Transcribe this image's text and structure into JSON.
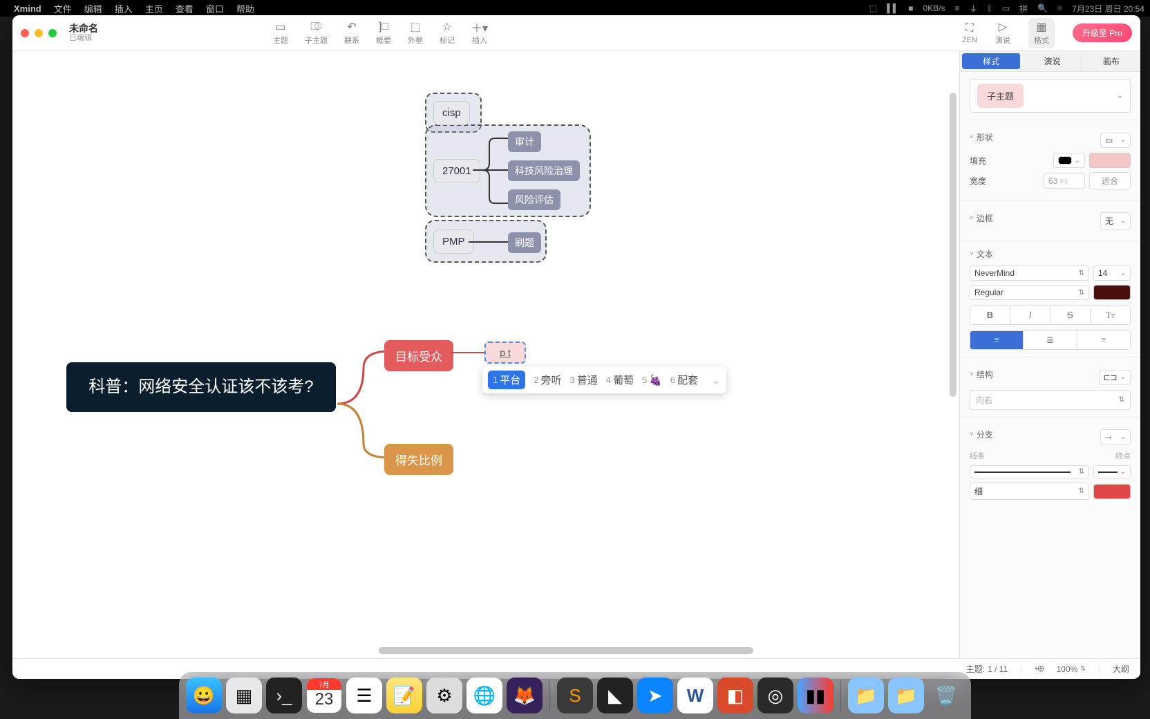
{
  "mac_menu": {
    "app_name": "Xmind",
    "items": [
      "文件",
      "编辑",
      "插入",
      "主页",
      "查看",
      "窗口",
      "帮助"
    ],
    "right_status": [
      "0KB/s",
      "7月23日 周日 20:54"
    ]
  },
  "window": {
    "title": "未命名",
    "subtitle": "已编辑",
    "upgrade": "升级至 Pro"
  },
  "toolbar": {
    "topic": "主题",
    "sub_topic": "子主题",
    "relation": "联系",
    "summary": "概要",
    "boundary": "外框",
    "marker": "标记",
    "insert": "插入",
    "zen": "ZEN",
    "presentation": "演说",
    "format": "格式"
  },
  "mindmap": {
    "central": "科普：网络安全认证该不该考?",
    "target_audience": "目标受众",
    "gain_loss": "得失比例",
    "editing_text": "p t",
    "cisp": "cisp",
    "iso": "27001",
    "audit": "审计",
    "tech_risk": "科技风险治理",
    "risk_assess": "风险评估",
    "pmp": "PMP",
    "shuati": "刷题"
  },
  "ime": {
    "options": [
      "平台",
      "旁听",
      "普通",
      "葡萄",
      "🍇",
      "配套"
    ]
  },
  "panel": {
    "tabs": {
      "style": "样式",
      "pitch": "演说",
      "canvas": "画布"
    },
    "topic_type": "子主题",
    "shape_label": "形状",
    "fill_label": "填充",
    "width_label": "宽度",
    "width_value": "63",
    "width_unit": "PX",
    "width_fit": "适合",
    "border_label": "边框",
    "border_value": "无",
    "text_label": "文本",
    "font_family": "NeverMind",
    "font_size": "14",
    "font_weight": "Regular",
    "structure_label": "结构",
    "structure_direction": "向右",
    "branch_label": "分支",
    "line_label": "线条",
    "endpoint_label": "终点",
    "line_width": "细"
  },
  "status": {
    "topic_counter_label": "主题:",
    "topic_counter": "1 / 11",
    "zoom": "100%",
    "outline": "大纲"
  },
  "dock": {
    "cal_month": "7月",
    "cal_day": "23"
  }
}
